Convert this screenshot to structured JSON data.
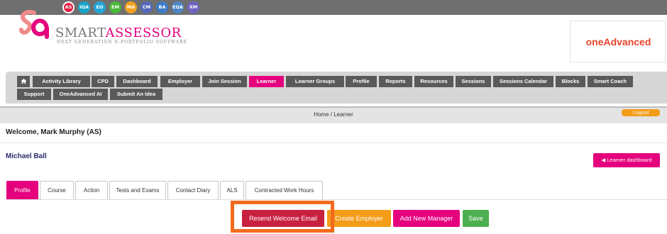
{
  "roles": [
    {
      "label": "AS",
      "color": "#e31d3f"
    },
    {
      "label": "IQA",
      "color": "#16a5c8"
    },
    {
      "label": "EO",
      "color": "#22a7d7"
    },
    {
      "label": "EM",
      "color": "#4bb83a"
    },
    {
      "label": "MA",
      "color": "#f3a21e"
    },
    {
      "label": "CM",
      "color": "#5668b8"
    },
    {
      "label": "BA",
      "color": "#3d7bc4"
    },
    {
      "label": "EQA",
      "color": "#4e86c6"
    },
    {
      "label": "XM",
      "color": "#6d64c1"
    }
  ],
  "brand": {
    "smart": "SMART",
    "assessor": "ASSESSOR",
    "tagline": "NEXT GENERATION E-PORTFOLIO SOFTWARE",
    "partner": "oneAdvanced"
  },
  "nav": {
    "home_icon": "home-icon",
    "items": [
      "Activity Library",
      "CPD",
      "Dashboard",
      "Employer",
      "Join Session",
      "Learner",
      "Learner Groups",
      "Profile",
      "Reports",
      "Resources",
      "Sessions",
      "Sessions Calendar",
      "Blocks",
      "Smart Coach",
      "Support",
      "OneAdvanced AI",
      "Submit An Idea"
    ],
    "active": "Learner"
  },
  "breadcrumb": "Home / Learner",
  "logout": "Logout",
  "welcome": "Welcome, Mark Murphy (AS)",
  "learner": {
    "name": "Michael Ball",
    "dashboard_button": "Learner dashboard"
  },
  "tabs": [
    "Profile",
    "Course",
    "Action",
    "Tests and Exams",
    "Contact Diary",
    "ALS",
    "Contracted Work Hours"
  ],
  "active_tab": "Profile",
  "actions": {
    "resend": "Resend Welcome Email",
    "create_employer": "Create Employer",
    "add_manager": "Add New Manager",
    "save": "Save"
  },
  "colors": {
    "accent": "#e5007e",
    "nav_button": "#5a5a5a",
    "resend": "#c9203f",
    "create_employer": "#f39c18",
    "add_manager": "#e5007e",
    "save": "#4caf50",
    "highlight": "#f26b1d"
  }
}
